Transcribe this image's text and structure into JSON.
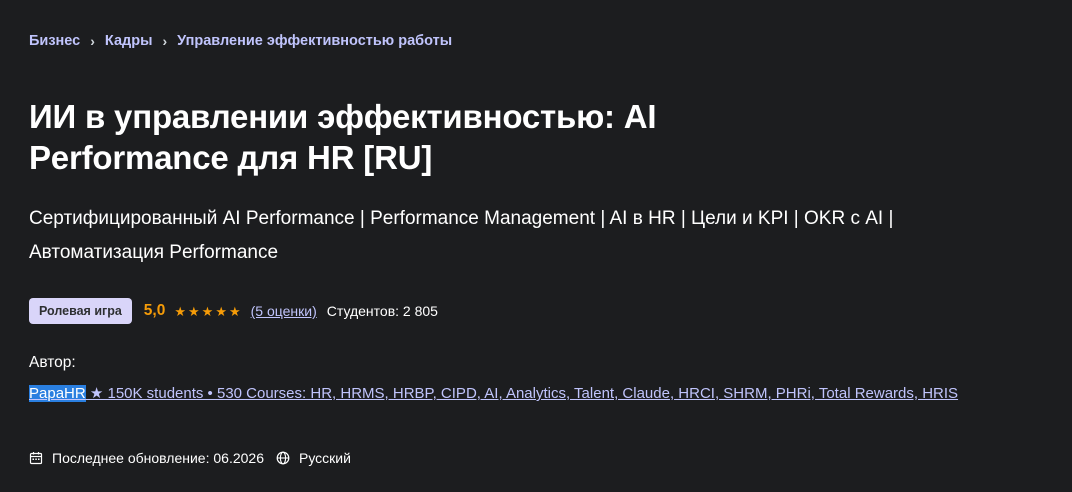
{
  "breadcrumb": {
    "items": [
      "Бизнес",
      "Кадры",
      "Управление эффективностью работы"
    ]
  },
  "course": {
    "title": "ИИ в управлении эффективностью: AI Performance для HR [RU]",
    "subtitle": "Сертифицированный AI Performance | Performance Management | AI в HR | Цели и KPI | OKR с AI | Автоматизация Performance",
    "badge": "Ролевая игра",
    "rating": "5,0",
    "stars": 5,
    "rating_count": "(5 оценки)",
    "students": "Студентов: 2 805",
    "author_label": "Автор:",
    "author_name": "PapaHR",
    "author_desc": " ★ 150K students • 530 Courses: HR, HRMS, HRBP, CIPD, AI, Analytics, Talent, Claude, HRCI, SHRM, PHRi, Total Rewards, HRIS",
    "updated": "Последнее обновление: 06.2026",
    "language": "Русский"
  },
  "colors": {
    "background": "#1c1d1f",
    "link": "#c0c4fc",
    "star": "#f69c08",
    "badge_bg": "#d9d5f9"
  }
}
